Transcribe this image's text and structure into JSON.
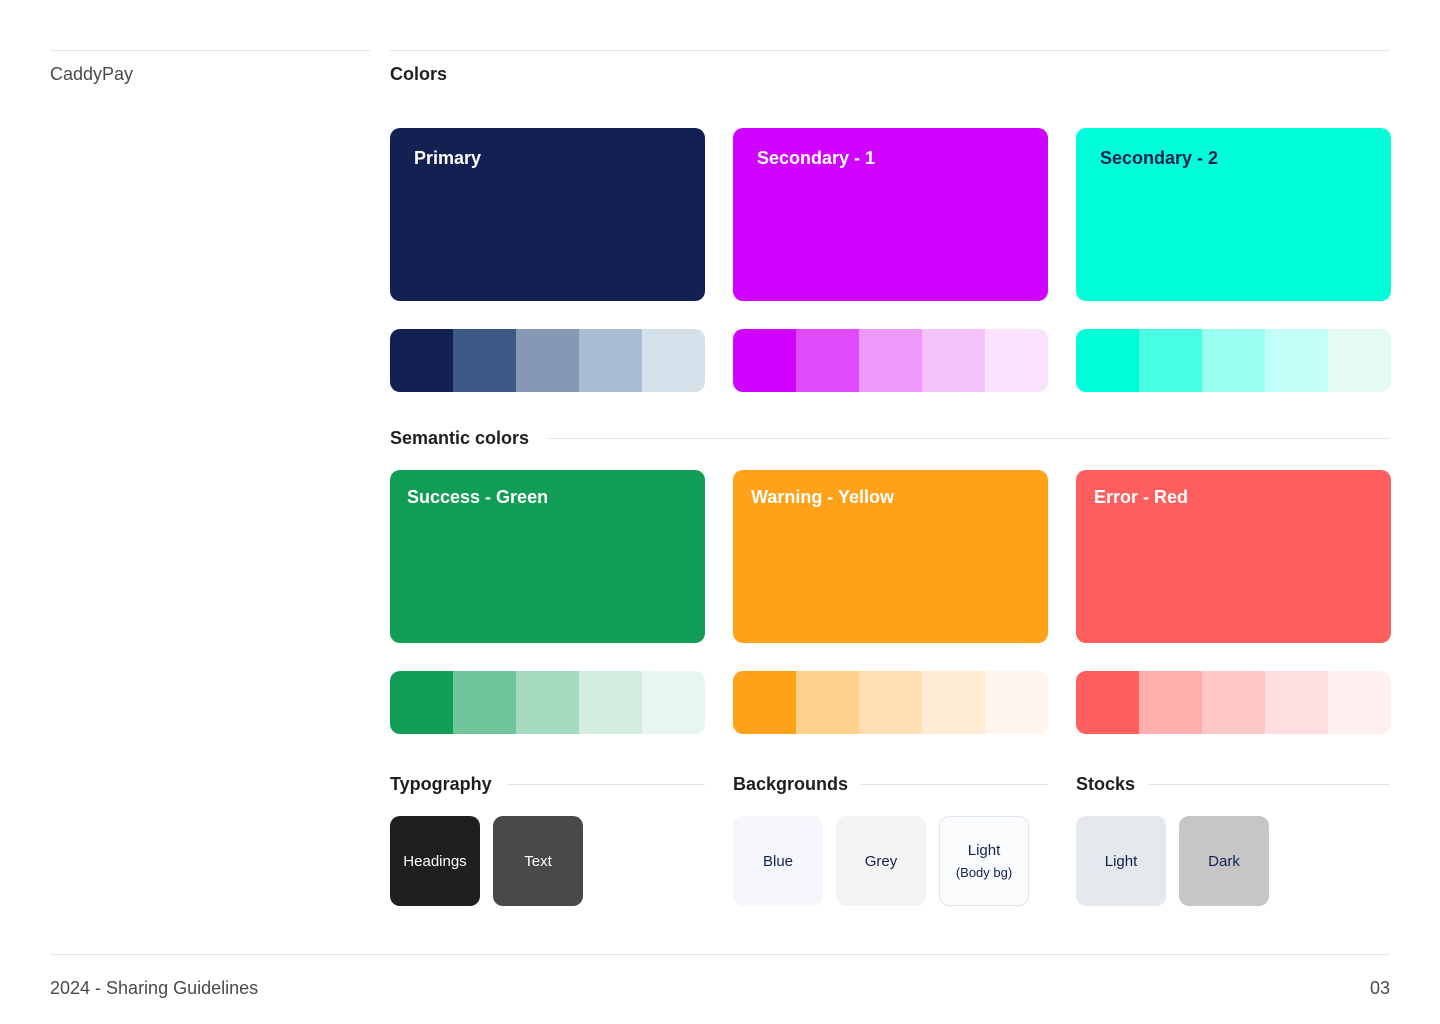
{
  "brand": "CaddyPay",
  "sections": {
    "colors": "Colors",
    "semantic": "Semantic colors",
    "typography": "Typography",
    "backgrounds": "Backgrounds",
    "stocks": "Stocks"
  },
  "brand_colors": [
    {
      "label": "Primary",
      "color": "#132152",
      "text_color": "#ffffff",
      "shades": [
        "#132152",
        "#3d5a86",
        "#8699b4",
        "#a8bdd3",
        "#d5e1ea"
      ]
    },
    {
      "label": "Secondary - 1",
      "color": "#cf03ff",
      "text_color": "#ffffff",
      "shades": [
        "#cf03ff",
        "#e24bfb",
        "#ee99f9",
        "#f5c2fb",
        "#fbe3fd"
      ]
    },
    {
      "label": "Secondary - 2",
      "color": "#00ffd8",
      "text_color": "#132152",
      "shades": [
        "#00ffd8",
        "#48ffe4",
        "#9afff0",
        "#c2fff6",
        "#e4fbf4"
      ]
    }
  ],
  "semantic_colors": [
    {
      "label": "Success - Green",
      "color": "#129d57",
      "text_color": "#ffffff",
      "shades": [
        "#129d57",
        "#70c59b",
        "#a3dac0",
        "#d4ede1",
        "#e8f6f3"
      ]
    },
    {
      "label": "Warning - Yellow",
      "color": "#ffa219",
      "text_color": "#ffffff",
      "shades": [
        "#ffa219",
        "#ffd18b",
        "#ffdfb1",
        "#ffecd3",
        "#fff5ec"
      ]
    },
    {
      "label": "Error - Red",
      "color": "#ff5e5e",
      "text_color": "#ffffff",
      "shades": [
        "#ff5e5e",
        "#ffadad",
        "#ffc8c8",
        "#ffdee2",
        "#fff0ef"
      ]
    }
  ],
  "typography": [
    {
      "label": "Headings",
      "bg": "#1f1f1f",
      "text_color": "#ffffff"
    },
    {
      "label": "Text",
      "bg": "#484a49",
      "text_color": "#ffffff"
    }
  ],
  "backgrounds": [
    {
      "label": "Blue",
      "sub": "",
      "bg": "#f5f7fc",
      "text_color": "#132152"
    },
    {
      "label": "Grey",
      "sub": "",
      "bg": "#f4f4f4",
      "text_color": "#132152"
    },
    {
      "label": "Light",
      "sub": "(Body bg)",
      "bg": "#fafbfd",
      "text_color": "#132152"
    }
  ],
  "stocks": [
    {
      "label": "Light",
      "bg": "#e5e8ec",
      "text_color": "#132152"
    },
    {
      "label": "Dark",
      "bg": "#c6c6c6",
      "text_color": "#132152"
    }
  ],
  "footer": {
    "left": "2024 - Sharing Guidelines",
    "page": "03"
  }
}
